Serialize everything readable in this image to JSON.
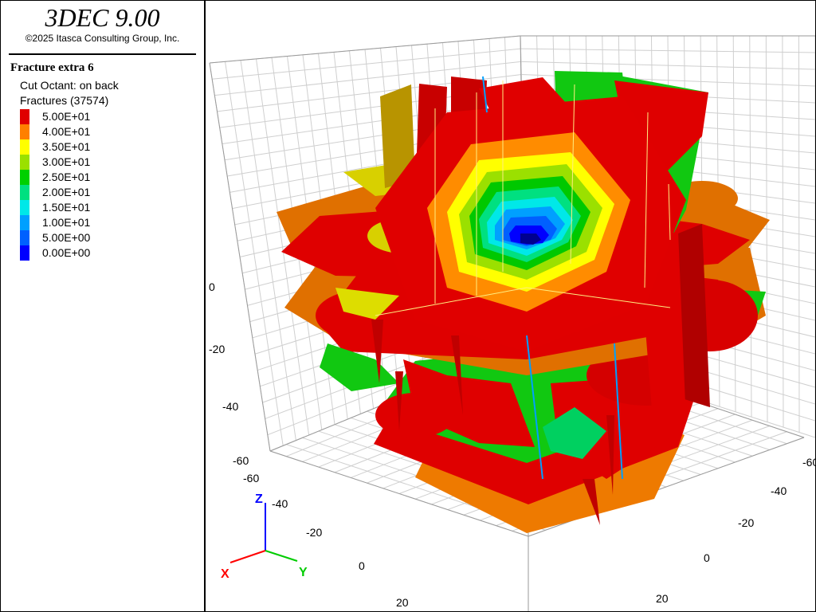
{
  "app": {
    "title": "3DEC 9.00",
    "copyright": "©2025 Itasca Consulting Group, Inc."
  },
  "plot": {
    "title": "Fracture extra 6",
    "subtitle": "Cut Octant: on back",
    "legend_heading": "Fractures (37574)",
    "legend": [
      {
        "label": "5.00E+01",
        "color": "#e00000"
      },
      {
        "label": "4.00E+01",
        "color": "#ff8000"
      },
      {
        "label": "3.50E+01",
        "color": "#ffff00"
      },
      {
        "label": "3.00E+01",
        "color": "#9be000"
      },
      {
        "label": "2.50E+01",
        "color": "#00d000"
      },
      {
        "label": "2.00E+01",
        "color": "#00e080"
      },
      {
        "label": "1.50E+01",
        "color": "#00e8e8"
      },
      {
        "label": "1.00E+01",
        "color": "#00a0ff"
      },
      {
        "label": "5.00E+00",
        "color": "#0060ff"
      },
      {
        "label": "0.00E+00",
        "color": "#0000ff"
      }
    ]
  },
  "axes": {
    "z_ticks": [
      "0",
      "-20",
      "-40",
      "-60"
    ],
    "x_ticks": [
      "-60",
      "-40",
      "-20",
      "0",
      "20"
    ],
    "y_ticks": [
      "-60",
      "-40",
      "-20",
      "0",
      "20"
    ],
    "triad": {
      "x": "X",
      "y": "Y",
      "z": "Z"
    },
    "colors": {
      "x": "#ff0000",
      "y": "#00cc00",
      "z": "#0000ff"
    }
  }
}
